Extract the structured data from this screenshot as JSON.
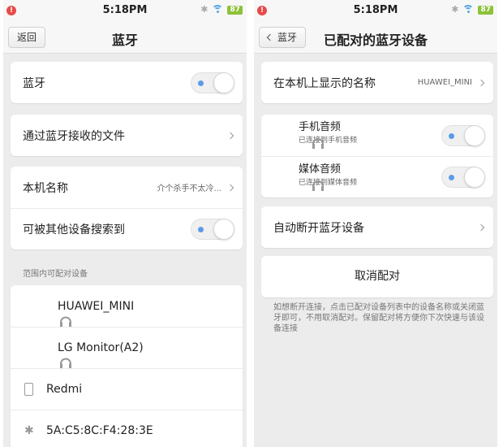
{
  "status_bar": {
    "time": "5:18PM",
    "battery": "87",
    "alert": "!"
  },
  "left": {
    "back_label": "返回",
    "title": "蓝牙",
    "bluetooth_label": "蓝牙",
    "bluetooth_on": true,
    "received_files_label": "通过蓝牙接收的文件",
    "device_name_label": "本机名称",
    "device_name_value": "介个杀手不太冷...",
    "discoverable_label": "可被其他设备搜索到",
    "discoverable_on": true,
    "available_section_label": "范围内可配对设备",
    "devices": [
      {
        "name": "HUAWEI_MINI",
        "icon": "headphones-icon"
      },
      {
        "name": "LG Monitor(A2)",
        "icon": "headphones-icon"
      },
      {
        "name": "Redmi",
        "icon": "phone-icon"
      },
      {
        "name": "5A:C5:8C:F4:28:3E",
        "icon": "bluetooth-icon"
      }
    ]
  },
  "right": {
    "back_label": "蓝牙",
    "title": "已配对的蓝牙设备",
    "display_name_label": "在本机上显示的名称",
    "display_name_value": "HUAWEI_MINI",
    "profiles": [
      {
        "label": "手机音频",
        "status": "已连接到手机音频",
        "on": true
      },
      {
        "label": "媒体音频",
        "status": "已连接到媒体音频",
        "on": true
      }
    ],
    "auto_disconnect_label": "自动断开蓝牙设备",
    "unpair_label": "取消配对",
    "note": "如想断开连接，点击已配对设备列表中的设备名称或关闭蓝牙即可，不用取消配对。保留配对将方便你下次快速与该设备连接"
  },
  "colors": {
    "accent": "#5b9be8",
    "battery": "#8dc23a",
    "alert": "#e84a4a"
  }
}
